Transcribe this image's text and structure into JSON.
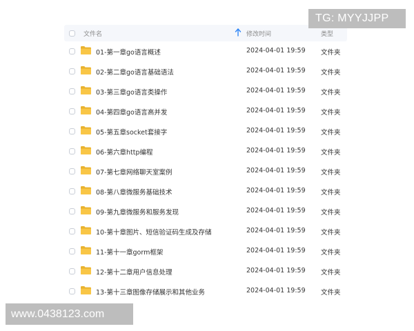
{
  "watermark": {
    "top": "TG: MYYJJPP",
    "bottom": "www.0438123.com"
  },
  "header": {
    "name": "文件名",
    "modified": "修改时间",
    "type": "类型"
  },
  "colors": {
    "folder": "#f9c646",
    "header_bg": "#f5f7fb",
    "sort_arrow": "#2f86f6",
    "watermark_bg": "#bdbdbd"
  },
  "files": [
    {
      "name": "01-第一章go语言概述",
      "time": "2024-04-01 19:59",
      "type": "文件夹",
      "icon": "folder-icon"
    },
    {
      "name": "02-第二章go语言基础语法",
      "time": "2024-04-01 19:59",
      "type": "文件夹",
      "icon": "folder-icon"
    },
    {
      "name": "03-第三章go语言类操作",
      "time": "2024-04-01 19:59",
      "type": "文件夹",
      "icon": "folder-icon"
    },
    {
      "name": "04-第四章go语言高并发",
      "time": "2024-04-01 19:59",
      "type": "文件夹",
      "icon": "folder-icon"
    },
    {
      "name": "05-第五章socket套接字",
      "time": "2024-04-01 19:59",
      "type": "文件夹",
      "icon": "folder-icon"
    },
    {
      "name": "06-第六章http编程",
      "time": "2024-04-01 19:59",
      "type": "文件夹",
      "icon": "folder-icon"
    },
    {
      "name": "07-第七章网络聊天室案例",
      "time": "2024-04-01 19:59",
      "type": "文件夹",
      "icon": "folder-icon"
    },
    {
      "name": "08-第八章微服务基础技术",
      "time": "2024-04-01 19:59",
      "type": "文件夹",
      "icon": "folder-icon"
    },
    {
      "name": "09-第九章微服务和服务发现",
      "time": "2024-04-01 19:59",
      "type": "文件夹",
      "icon": "folder-icon"
    },
    {
      "name": "10-第十章图片、短信验证码生成及存储",
      "time": "2024-04-01 19:59",
      "type": "文件夹",
      "icon": "folder-icon"
    },
    {
      "name": "11-第十一章gorm框架",
      "time": "2024-04-01 19:59",
      "type": "文件夹",
      "icon": "folder-icon"
    },
    {
      "name": "12-第十二章用户信息处理",
      "time": "2024-04-01 19:59",
      "type": "文件夹",
      "icon": "folder-icon"
    },
    {
      "name": "13-第十三章图像存储展示和其他业务",
      "time": "2024-04-01 19:59",
      "type": "文件夹",
      "icon": "folder-icon"
    }
  ]
}
